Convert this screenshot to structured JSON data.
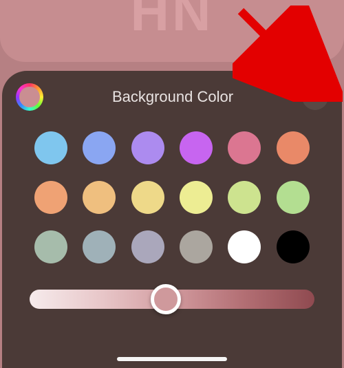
{
  "monogram": "HN",
  "panel": {
    "title": "Background Color",
    "slider_percent": 48,
    "swatches": [
      "#7fc6ee",
      "#8aa6f2",
      "#ac8bef",
      "#c765f0",
      "#db7691",
      "#e98968",
      "#efa274",
      "#efbf7f",
      "#eed989",
      "#eded93",
      "#cde38f",
      "#b3de91",
      "#a6bcab",
      "#9fb1b8",
      "#aaa7bb",
      "#aba69f",
      "#ffffff",
      "#000000"
    ]
  }
}
